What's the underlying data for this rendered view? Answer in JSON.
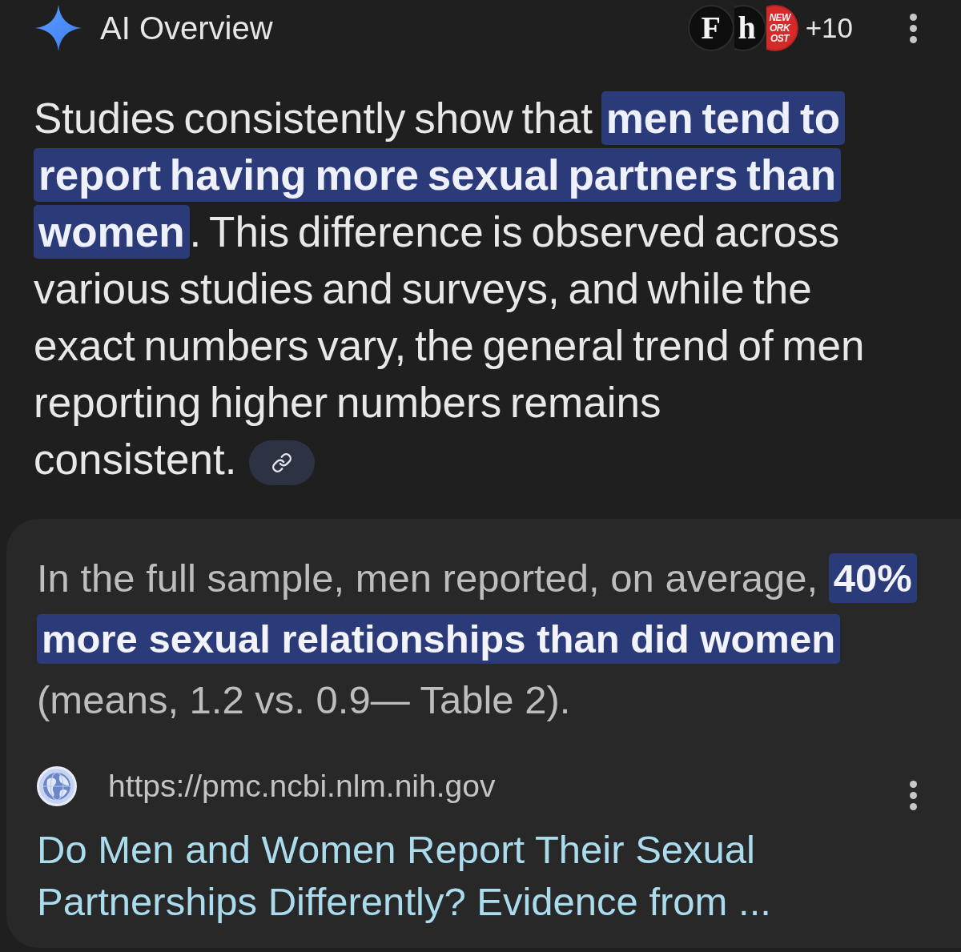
{
  "header": {
    "title": "AI Overview",
    "sources": [
      {
        "kind": "serif-letter",
        "lines": [
          "F"
        ]
      },
      {
        "kind": "serif-letter",
        "lines": [
          "h"
        ]
      },
      {
        "kind": "stacked-wordmark",
        "lines": [
          "NEW",
          "ORK",
          "OST"
        ]
      }
    ],
    "more": "+10"
  },
  "answer": {
    "text": "Studies consistently show that **men tend to report having more sexual partners than women**. This difference is observed across various studies and surveys, and while the exact numbers vary, the general trend of men reporting higher numbers remains consistent."
  },
  "quote": {
    "text": "In the full sample, men reported, on average, **40% more sexual relationships than did women** (means, 1.2 vs. 0.9— Table 2).",
    "source": {
      "url": "https://pmc.ncbi.nlm.nih.gov",
      "title": "Do Men and Women Report Their Sexual Partnerships Differently? Evidence from ..."
    }
  }
}
